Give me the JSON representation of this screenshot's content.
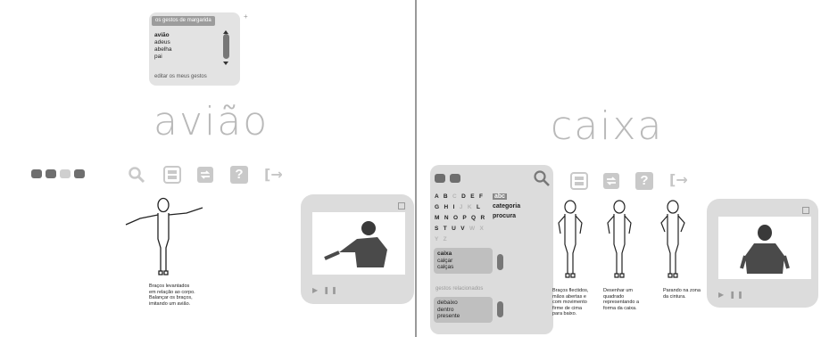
{
  "left": {
    "dropdown": {
      "title": "os gestos de margarida",
      "items": [
        "avião",
        "adeus",
        "abelha",
        "pai"
      ],
      "footer": "editar os meus gestos",
      "plus": "+"
    },
    "word": "avião",
    "caption": [
      "Braços levantados",
      "em relação ao corpo.",
      "Balançar os braços,",
      "imitando um avião."
    ]
  },
  "right": {
    "word": "caixa",
    "letters_rows": [
      [
        "A",
        "B",
        "C",
        "D",
        "E",
        "F"
      ],
      [
        "G",
        "H",
        "I",
        "J",
        "K",
        "L"
      ],
      [
        "M",
        "N",
        "O",
        "P",
        "Q",
        "R"
      ],
      [
        "S",
        "T",
        "U",
        "V",
        "W",
        "X"
      ],
      [
        "Y",
        "Z"
      ]
    ],
    "modes": [
      "abc",
      "categoria",
      "procura"
    ],
    "words": [
      "caixa",
      "calçar",
      "calças"
    ],
    "related_label": "gestos relacionados",
    "related": [
      "debaixo",
      "dentro",
      "presente"
    ],
    "captions": [
      [
        "Braços flectidos,",
        "mãos abertas e",
        "com movimento",
        "firme de cima",
        "para baixo."
      ],
      [
        "Desenhar um",
        "quadrado",
        "representando a",
        "forma da caixa."
      ],
      [
        "Parando na zona",
        "da cintura."
      ]
    ]
  },
  "video_controls": "▶ ❚❚",
  "icons": {
    "search": "search-icon",
    "list": "list-icon",
    "swap": "swap-icon",
    "help": "help-icon",
    "exit": "exit-icon"
  },
  "help_glyph": "?",
  "exit_glyph": "[→"
}
